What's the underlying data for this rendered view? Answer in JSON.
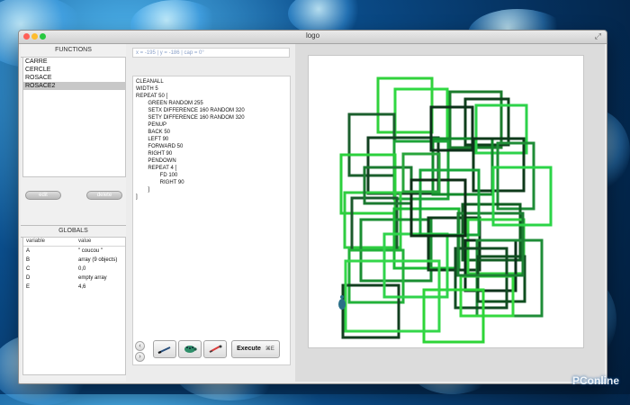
{
  "window": {
    "title": "logo"
  },
  "functions": {
    "title": "FUNCTIONS",
    "items": [
      "CARRE",
      "CERCLE",
      "ROSACE",
      "ROSACE2"
    ],
    "selected_index": 3,
    "buttons": {
      "edit": "edit",
      "delete": "delete"
    }
  },
  "globals": {
    "title": "GLOBALS",
    "headers": {
      "variable": "variable",
      "value": "value"
    },
    "rows": [
      {
        "variable": "A",
        "value": "\" coucou \""
      },
      {
        "variable": "B",
        "value": "array (9 objects)"
      },
      {
        "variable": "C",
        "value": "0,0"
      },
      {
        "variable": "D",
        "value": "empty array"
      },
      {
        "variable": "E",
        "value": "4,6"
      }
    ]
  },
  "editor": {
    "coords": "x = -195 | y = -186 | cap = 0°",
    "lines": [
      "CLEANALL",
      "",
      "WIDTH 5",
      "",
      "REPEAT 50 [",
      "        GREEN RANDOM 255",
      "        SETX DIFFERENCE 160 RANDOM 320",
      "        SETY DIFFERENCE 160 RANDOM 320",
      "        PENUP",
      "        BACK 50",
      "        LEFT 90",
      "        FORWARD 50",
      "        RIGHT 90",
      "        PENDOWN",
      "",
      "        REPEAT 4 [",
      "                FD 100",
      "                RIGHT 90",
      "        ]",
      "]"
    ],
    "execute": {
      "label": "Execute",
      "shortcut": "⌘E"
    }
  },
  "icons": {
    "prev": "chevron-left-icon",
    "next": "chevron-right-icon",
    "pen_tool": "pen-icon",
    "turtle_tool": "turtle-icon",
    "brush_tool": "brush-icon"
  },
  "colors": {
    "pen_dark": "#113f1f",
    "pen_mid": "#16a634",
    "pen_bright": "#33d43b",
    "turtle": "#2a6f88"
  },
  "watermark": "PConline"
}
